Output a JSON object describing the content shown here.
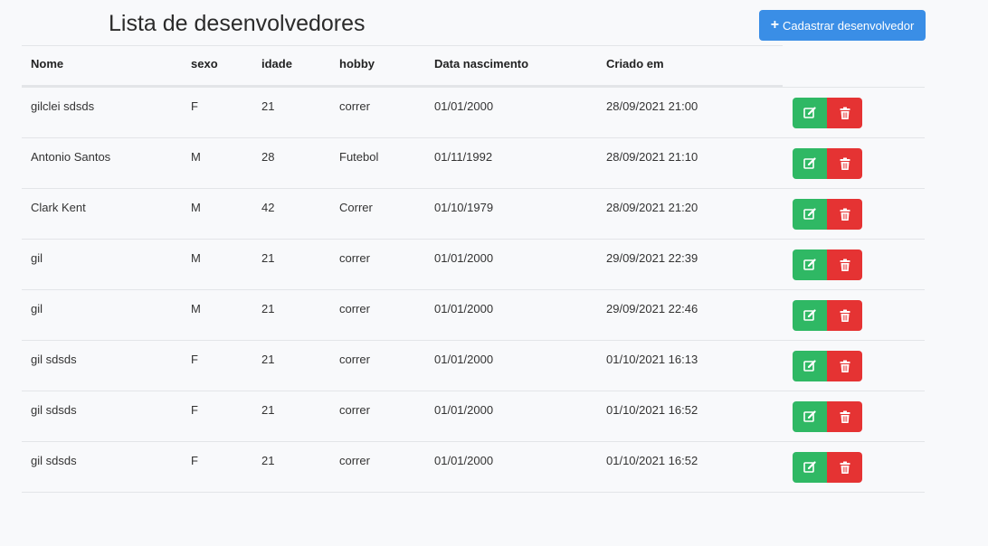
{
  "page": {
    "title": "Lista de desenvolvedores",
    "add_button_label": "Cadastrar desenvolvedor"
  },
  "table": {
    "headers": [
      "Nome",
      "sexo",
      "idade",
      "hobby",
      "Data nascimento",
      "Criado em"
    ],
    "rows": [
      [
        "gilclei sdsds",
        "F",
        "21",
        "correr",
        "01/01/2000",
        "28/09/2021 21:00"
      ],
      [
        "Antonio Santos",
        "M",
        "28",
        "Futebol",
        "01/11/1992",
        "28/09/2021 21:10"
      ],
      [
        "Clark Kent",
        "M",
        "42",
        "Correr",
        "01/10/1979",
        "28/09/2021 21:20"
      ],
      [
        "gil",
        "M",
        "21",
        "correr",
        "01/01/2000",
        "29/09/2021 22:39"
      ],
      [
        "gil",
        "M",
        "21",
        "correr",
        "01/01/2000",
        "29/09/2021 22:46"
      ],
      [
        "gil sdsds",
        "F",
        "21",
        "correr",
        "01/01/2000",
        "01/10/2021 16:13"
      ],
      [
        "gil sdsds",
        "F",
        "21",
        "correr",
        "01/01/2000",
        "01/10/2021 16:52"
      ],
      [
        "gil sdsds",
        "F",
        "21",
        "correr",
        "01/01/2000",
        "01/10/2021 16:52"
      ]
    ]
  },
  "icons": {
    "add": "plus-icon",
    "edit": "edit-icon",
    "delete": "trash-icon"
  },
  "colors": {
    "primary": "#3a8ee6",
    "success": "#2fb864",
    "danger": "#e53333"
  }
}
